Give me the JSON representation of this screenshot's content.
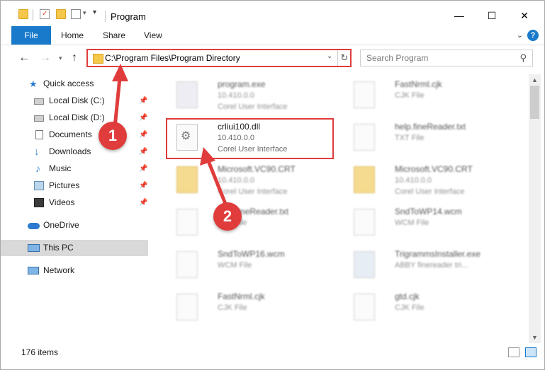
{
  "window": {
    "title": "Program",
    "buttons": {
      "minimize": "—",
      "maximize": "☐",
      "close": "✕"
    }
  },
  "ribbon": {
    "tabs": [
      "File",
      "Home",
      "Share",
      "View"
    ],
    "help": "?"
  },
  "address": {
    "path": "C:\\Program Files\\Program Directory",
    "search_placeholder": "Search Program"
  },
  "nav": {
    "items": [
      {
        "label": "Quick access",
        "icon": "star-icon"
      },
      {
        "label": "Local Disk (C:)",
        "icon": "drive-icon"
      },
      {
        "label": "Local Disk (D:)",
        "icon": "drive-icon"
      },
      {
        "label": "Documents",
        "icon": "documents-icon"
      },
      {
        "label": "Downloads",
        "icon": "download-icon"
      },
      {
        "label": "Music",
        "icon": "music-icon"
      },
      {
        "label": "Pictures",
        "icon": "pictures-icon"
      },
      {
        "label": "Videos",
        "icon": "videos-icon"
      },
      {
        "label": "OneDrive",
        "icon": "cloud-icon"
      },
      {
        "label": "This PC",
        "icon": "computer-icon"
      },
      {
        "label": "Network",
        "icon": "network-icon"
      }
    ]
  },
  "files": {
    "col1": [
      {
        "name": "program.exe",
        "line2": "10.410.0.0",
        "line3": "Corel User Interface"
      },
      {
        "name": "crliui100.dll",
        "line2": "10.410.0.0",
        "line3": "Corel User Interface"
      },
      {
        "name": "Microsoft.VC90.CRT",
        "line2": "10.410.0.0",
        "line3": "Corel User Interface"
      },
      {
        "name": "help.fineReader.txt",
        "line2": "TXT File",
        "line3": ""
      },
      {
        "name": "SndToWP16.wcm",
        "line2": "WCM File",
        "line3": ""
      },
      {
        "name": "FastNrml.cjk",
        "line2": "CJK File",
        "line3": ""
      }
    ],
    "col2": [
      {
        "name": "FastNrml.cjk",
        "line2": "CJK File",
        "line3": ""
      },
      {
        "name": "help.fineReader.txt",
        "line2": "TXT File",
        "line3": ""
      },
      {
        "name": "Microsoft.VC90.CRT",
        "line2": "10.410.0.0",
        "line3": "Corel User Interface"
      },
      {
        "name": "SndToWP14.wcm",
        "line2": "WCM File",
        "line3": ""
      },
      {
        "name": "TrigrammsInstaller.exe",
        "line2": "ABBY finereader tri...",
        "line3": ""
      },
      {
        "name": "gtd.cjk",
        "line2": "CJK File",
        "line3": ""
      }
    ]
  },
  "status": {
    "items": "176 items"
  },
  "annotations": {
    "badge1": "1",
    "badge2": "2"
  },
  "colors": {
    "accent": "#1979ca",
    "highlight": "#e03c3c"
  }
}
